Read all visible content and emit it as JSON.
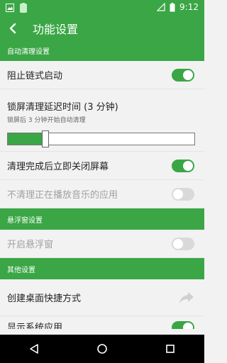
{
  "status_bar": {
    "time": "9:12"
  },
  "toolbar": {
    "title": "功能设置"
  },
  "sections": {
    "auto_clean": "自动清理设置",
    "floating_window": "悬浮窗设置",
    "other": "其他设置"
  },
  "items": {
    "block_chain_start": {
      "label": "阻止链式启动",
      "enabled": true
    },
    "lock_delay": {
      "label": "锁屏清理延迟时间 (3 分钟)",
      "sub": "锁屏后 3 分钟开始自动清理",
      "level_fraction": 0.2
    },
    "turn_off_screen": {
      "label": "清理完成后立即关闭屏幕",
      "enabled": true
    },
    "skip_music_apps": {
      "label": "不清理正在播放音乐的应用",
      "enabled": false
    },
    "enable_floating": {
      "label": "开启悬浮窗",
      "enabled": false
    },
    "create_shortcut": {
      "label": "创建桌面快捷方式"
    },
    "show_system_apps": {
      "label": "显示系统应用",
      "enabled": true
    }
  },
  "colors": {
    "accent": "#3aa645",
    "toggle_off": "#d9d9d9"
  }
}
